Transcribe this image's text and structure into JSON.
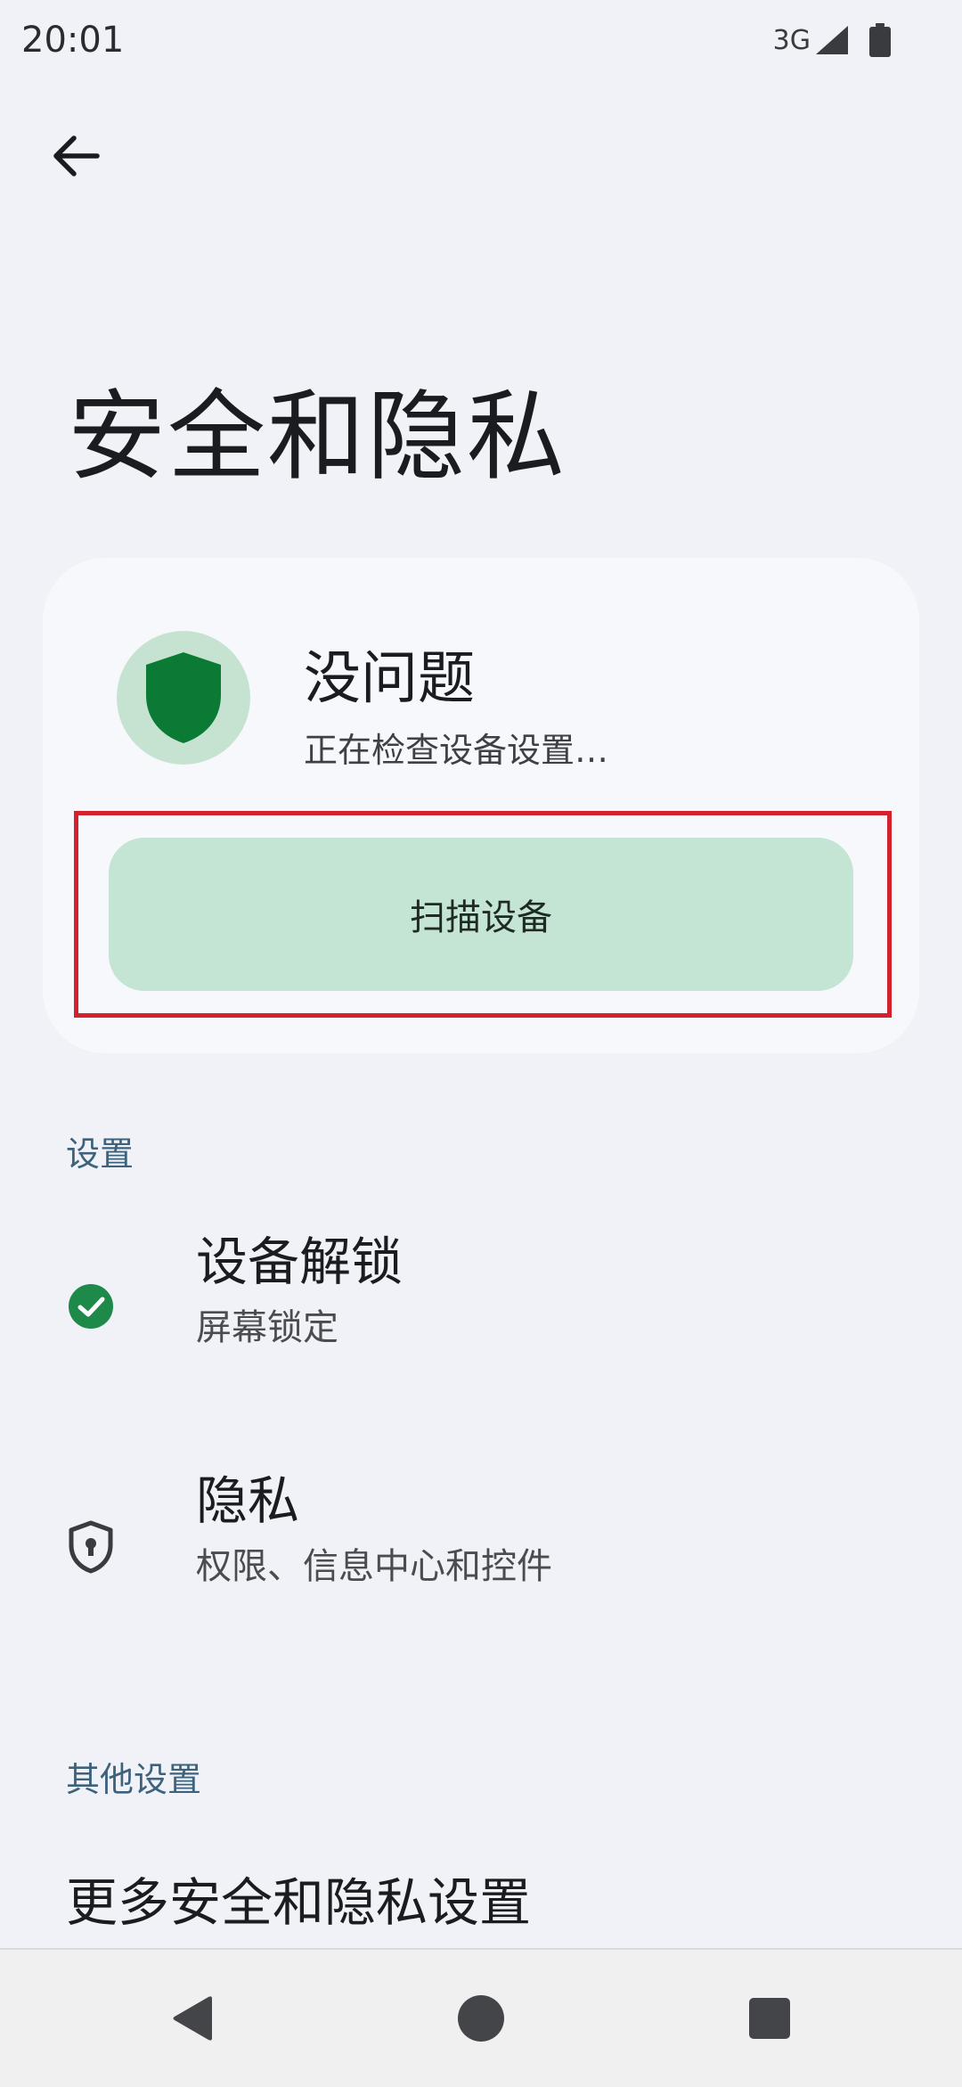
{
  "status_bar": {
    "time": "20:01",
    "network": "3G",
    "icons": [
      "signal-icon",
      "battery-icon"
    ]
  },
  "header": {
    "back_icon": "back-arrow-icon",
    "title": "安全和隐私"
  },
  "status_card": {
    "icon": "shield-icon",
    "title": "没问题",
    "subtitle": "正在检查设备设置…",
    "scan_button_label": "扫描设备"
  },
  "sections": {
    "settings_header": "设置",
    "items": [
      {
        "icon": "check-circle-icon",
        "title": "设备解锁",
        "subtitle": "屏幕锁定"
      },
      {
        "icon": "privacy-shield-lock-icon",
        "title": "隐私",
        "subtitle": "权限、信息中心和控件"
      }
    ],
    "other_header": "其他设置",
    "more_item": "更多安全和隐私设置"
  },
  "nav_bar": {
    "icons": [
      "back-triangle-icon",
      "home-circle-icon",
      "recents-square-icon"
    ]
  },
  "colors": {
    "background": "#f0f2f7",
    "card": "#f7f8fc",
    "accent_green": "#0b7a35",
    "button_green": "#c5e5d4",
    "section_header": "#3d627c",
    "highlight_red": "#d4222c"
  }
}
